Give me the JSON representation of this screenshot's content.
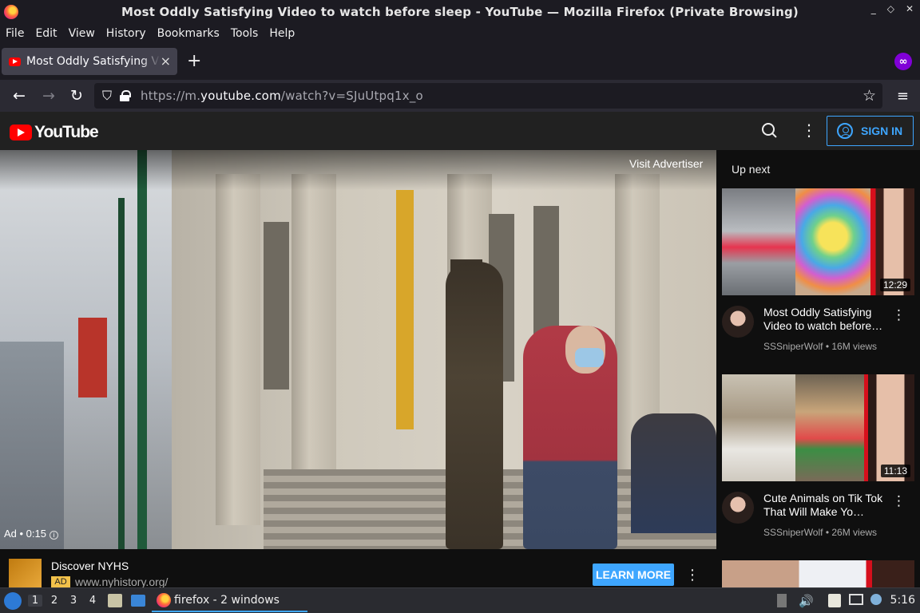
{
  "window": {
    "title": "Most Oddly Satisfying Video to watch before sleep - YouTube — Mozilla Firefox (Private Browsing)",
    "minimize": "_",
    "maximize": "◇",
    "close": "✕"
  },
  "menubar": [
    "File",
    "Edit",
    "View",
    "History",
    "Bookmarks",
    "Tools",
    "Help"
  ],
  "tab": {
    "label": "Most Oddly Satisfying Video to watch before sleep - YouTube",
    "close": "×",
    "new_tab": "+"
  },
  "navbar": {
    "back": "←",
    "forward": "→",
    "reload": "↻",
    "url_prefix": "https://m.",
    "url_domain": "youtube.com",
    "url_suffix": "/watch?v=SJuUtpq1x_o",
    "star": "☆",
    "menu": "≡"
  },
  "youtube": {
    "logo_text": "YouTube",
    "kebab": "⋮",
    "sign_in": "SIGN IN"
  },
  "player": {
    "visit_advertiser": "Visit Advertiser",
    "ad_label": "Ad • 0:15",
    "info": "i"
  },
  "ad": {
    "title": "Discover NYHS",
    "badge": "AD",
    "url": "www.nyhistory.org/",
    "cta": "LEARN MORE",
    "kebab": "⋮"
  },
  "sidebar": {
    "heading": "Up next",
    "videos": [
      {
        "title": "Most Oddly Satisfying Video to watch before…",
        "channel": "SSSniperWolf",
        "views": "16M views",
        "duration": "12:29"
      },
      {
        "title": "Cute Animals on Tik Tok That Will Make Yo…",
        "channel": "SSSniperWolf",
        "views": "26M views",
        "duration": "11:13"
      }
    ],
    "separator": " • ",
    "kebab": "⋮"
  },
  "taskbar": {
    "workspaces": [
      "1",
      "2",
      "3",
      "4"
    ],
    "task_label": "firefox - 2 windows",
    "clock": "5:16"
  },
  "colors": {
    "accent": "#3ea6ff",
    "youtube_red": "#ff0000",
    "private_purple": "#8000d7"
  }
}
